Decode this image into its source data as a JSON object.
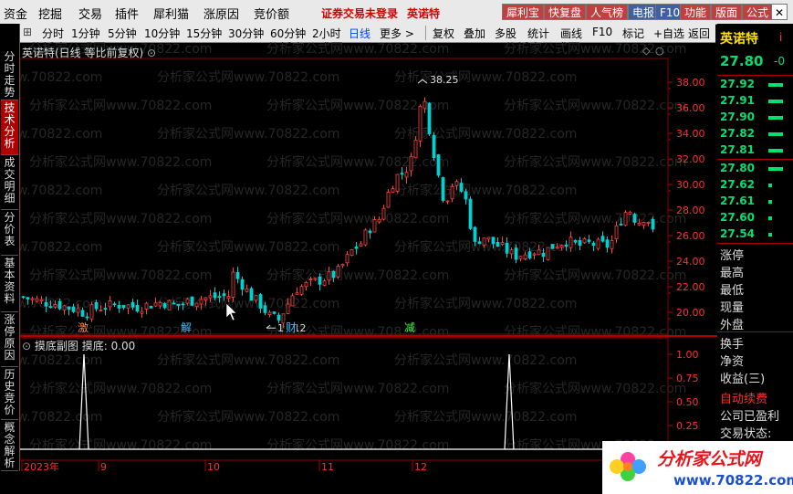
{
  "menu": {
    "items": [
      "资金",
      "挖掘",
      "交易",
      "插件",
      "犀利猫",
      "涨原因",
      "竞价额"
    ],
    "login_warning": "证券交易未登录",
    "stock_name": "英诺特",
    "right_buttons": [
      {
        "label": "犀利宝",
        "color": "#c04040"
      },
      {
        "label": "快复盘",
        "color": "#c04040"
      },
      {
        "label": "人气榜",
        "color": "#c04040"
      },
      {
        "label": "电报",
        "color": "#4060a0"
      },
      {
        "label": "F10",
        "color": "#4060a0"
      },
      {
        "label": "功能",
        "color": "#c04040"
      },
      {
        "label": "版面",
        "color": "#c04040"
      },
      {
        "label": "公式",
        "color": "#c04040"
      }
    ]
  },
  "period_tabs": [
    "分时",
    "1分钟",
    "5分钟",
    "10分钟",
    "15分钟",
    "30分钟",
    "60分钟",
    "2小时",
    "日线",
    "更多 >"
  ],
  "active_period": "日线",
  "tools": [
    "复权",
    "叠加",
    "多股",
    "统计",
    "画线",
    "F10",
    "标记",
    "+自选",
    "返回"
  ],
  "left_tabs": [
    "分时走势",
    "技术分析",
    "成交明细",
    "分价表",
    "基本资料",
    "涨停原因",
    "历史竞价",
    "概念解析"
  ],
  "active_left_tab": "技术分析",
  "chart_title": "英诺特(日线 等比前复权)",
  "sub_title": "摸底副图 摸底: 0.00",
  "watermark": "分析家公式网www.70822.com",
  "main_chart": {
    "y_ticks": [
      "38.00",
      "36.00",
      "34.00",
      "32.00",
      "30.00",
      "28.00",
      "26.00",
      "24.00",
      "22.00",
      "20.00"
    ],
    "high_label": "38.25",
    "low_label": "19.12",
    "markers": [
      {
        "text": "激",
        "color": "#ff8040"
      },
      {
        "text": "解",
        "color": "#40c0ff"
      },
      {
        "text": "财",
        "color": "#40c0ff"
      },
      {
        "text": "减",
        "color": "#40ff40"
      }
    ]
  },
  "sub_chart": {
    "y_ticks": [
      "1.00",
      "0.75",
      "0.50",
      "0.25"
    ],
    "x_labels": [
      "2023年",
      "9",
      "10",
      "11",
      "12"
    ]
  },
  "right_panel": {
    "name": "英诺特",
    "price": "27.80",
    "change": "-0",
    "asks": [
      "27.92",
      "27.91",
      "27.90",
      "27.82",
      "27.81"
    ],
    "bids": [
      "27.80",
      "27.62",
      "27.61",
      "27.60",
      "27.54"
    ],
    "labels": [
      "涨停",
      "最高",
      "最低",
      "现量",
      "外盘",
      "换手",
      "净资",
      "收益(三)"
    ],
    "auto_renew": "自动续费",
    "company": "公司已盈利",
    "trade_status": "交易状态:"
  },
  "logo": {
    "text": "分析家公式网",
    "url": "www.70822.com"
  },
  "colors": {
    "up": "#ff4040",
    "down": "#00d0d0",
    "axis": "#b00000",
    "accent": "#ffe000"
  }
}
